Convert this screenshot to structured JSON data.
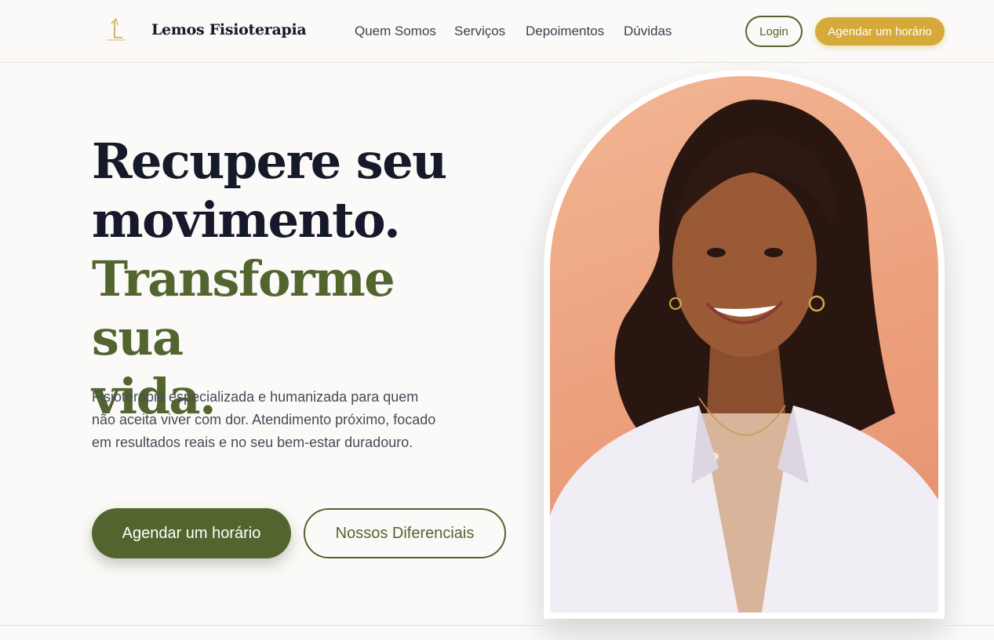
{
  "header": {
    "brand": "Lemos Fisioterapia",
    "nav": [
      "Quem Somos",
      "Serviços",
      "Depoimentos",
      "Dúvidas"
    ],
    "login_label": "Login",
    "cta_label": "Agendar um horário"
  },
  "hero": {
    "headline_line1": "Recupere seu",
    "headline_line2": "movimento.",
    "headline_line3": "Transforme sua",
    "headline_line4": "vida.",
    "subtitle": "Fisioterapia especializada e humanizada para quem não aceita viver com dor. Atendimento próximo, focado em resultados reais e no seu bem-estar duradouro.",
    "primary_button": "Agendar um horário",
    "secondary_button": "Nossos Diferenciais"
  },
  "colors": {
    "accent_green": "#53652f",
    "accent_gold": "#d6aa3a",
    "heading_dark": "#15192a",
    "background": "#fbfaf8"
  },
  "icons": {
    "logo": "brand-logo-icon"
  }
}
